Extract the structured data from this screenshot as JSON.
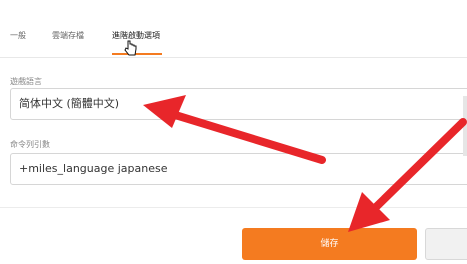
{
  "tabs": {
    "items": [
      {
        "label": "一般"
      },
      {
        "label": "雲端存檔"
      },
      {
        "label": "進階啟動選項"
      }
    ],
    "active_index": 2
  },
  "form": {
    "language_label": "遊戲語言",
    "language_value": "简体中文 (簡體中文)",
    "cmd_label": "命令列引數",
    "cmd_value": "+miles_language japanese"
  },
  "footer": {
    "save_label": "儲存",
    "cancel_label": ""
  },
  "colors": {
    "accent": "#f47b20",
    "annotation_arrow": "#e8262a"
  }
}
